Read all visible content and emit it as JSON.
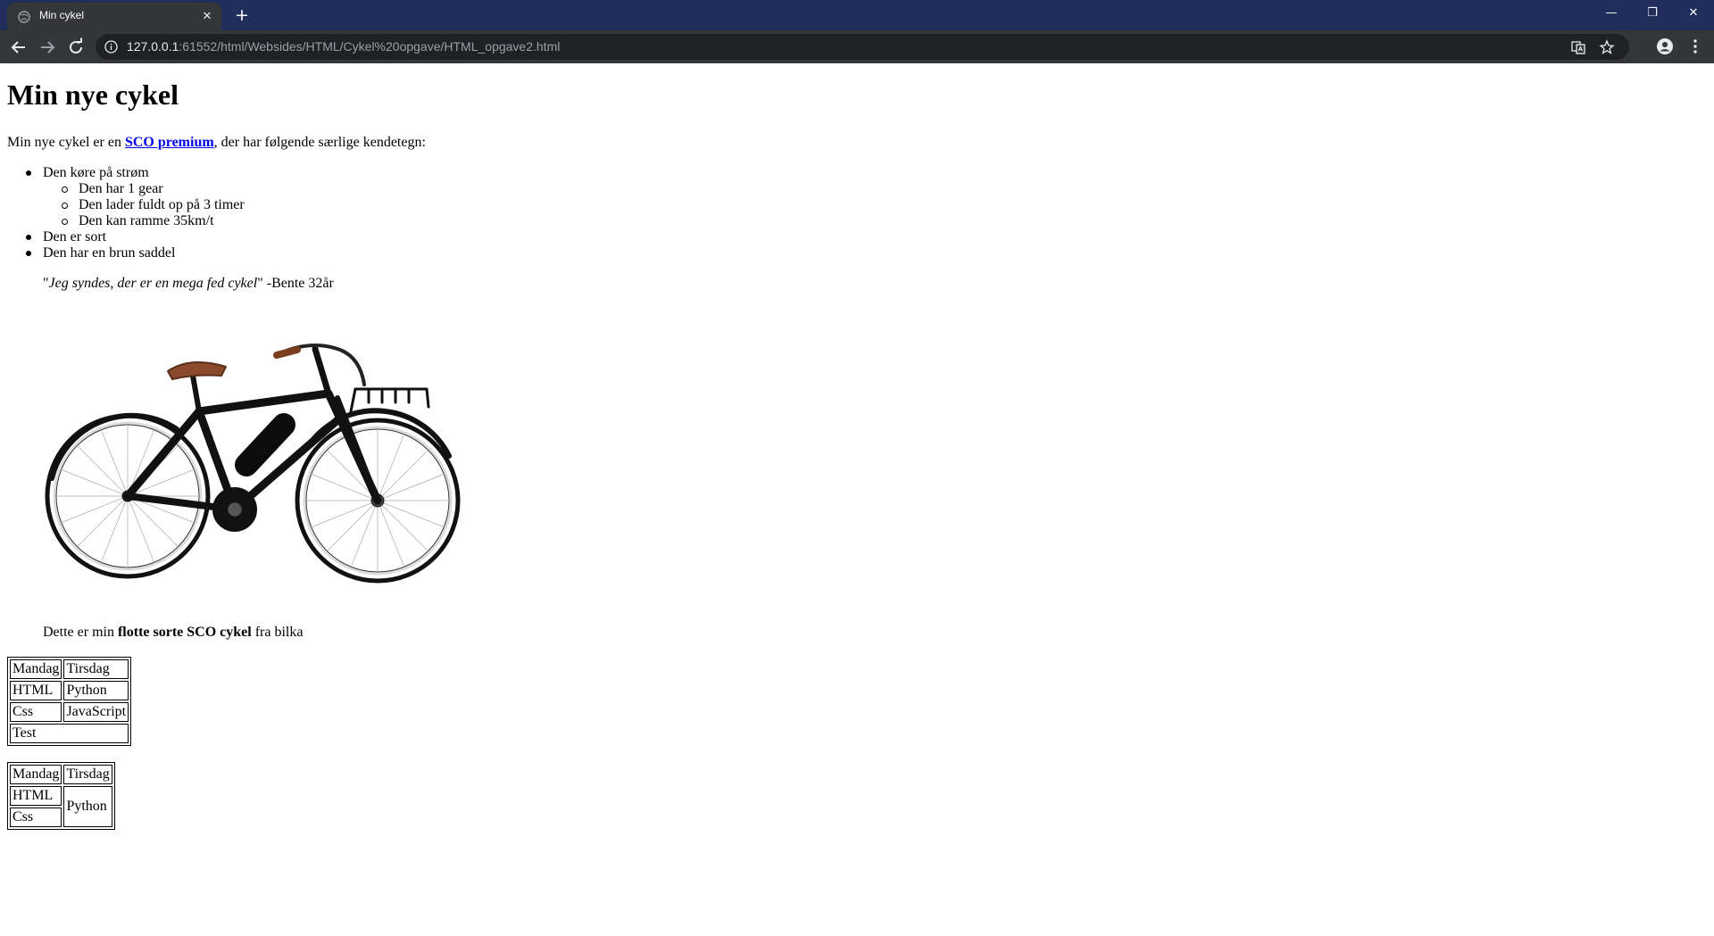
{
  "browser": {
    "tab_title": "Min cykel",
    "new_tab_symbol": "+",
    "close_symbol": "✕",
    "window_controls": {
      "minimize": "—",
      "maximize": "❐",
      "close": "✕"
    },
    "url_host": "127.0.0.1",
    "url_rest": ":61552/html/Websides/HTML/Cykel%20opgave/HTML_opgave2.html",
    "icons": [
      "back-arrow-icon",
      "forward-arrow-icon",
      "reload-icon",
      "site-info-icon",
      "translate-icon",
      "star-icon",
      "profile-icon",
      "kebab-menu-icon"
    ],
    "colors": {
      "titlebar": "#1f2e5a",
      "toolbar": "#35363a",
      "omnibox": "#202124"
    }
  },
  "page": {
    "title": "Min nye cykel",
    "intro": {
      "before": "Min nye cykel er en ",
      "link": "SCO premium",
      "after": ", der har følgende særlige kendetegn:"
    },
    "list": [
      {
        "text": "Den køre på strøm",
        "sub": [
          "Den har 1 gear",
          "Den lader fuldt op på 3 timer",
          "Den kan ramme 35km/t"
        ]
      },
      {
        "text": "Den er sort"
      },
      {
        "text": "Den har en brun saddel"
      }
    ],
    "quote": {
      "open": "\"",
      "text": "Jeg syndes, der er en mega fed cykel",
      "close": "\"",
      "author": " -Bente 32år"
    },
    "image": {
      "subject": "black electric city bike with brown saddle and front rack"
    },
    "caption": {
      "before": "Dette er min ",
      "bold": "flotte sorte SCO cykel",
      "after": " fra bilka"
    },
    "table1": {
      "rows": [
        [
          "Mandag",
          "Tirsdag"
        ],
        [
          "HTML",
          "Python"
        ],
        [
          "Css",
          "JavaScript"
        ]
      ],
      "footer": "Test"
    },
    "table2": {
      "header": [
        "Mandag",
        "Tirsdag"
      ],
      "col1": [
        "HTML",
        "Css"
      ],
      "merged": "Python"
    }
  }
}
